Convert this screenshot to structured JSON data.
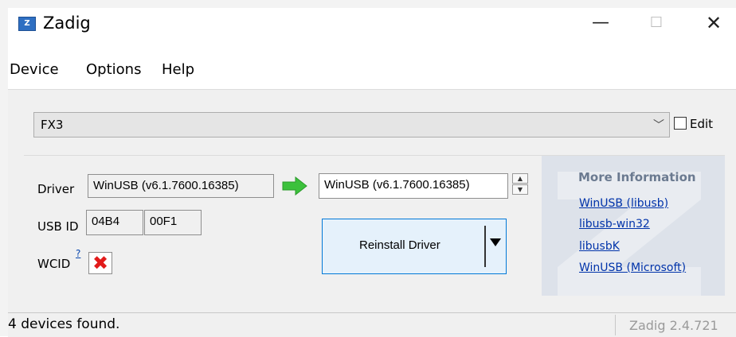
{
  "window": {
    "title": "Zadig",
    "icon_letter": "Z",
    "minimize_glyph": "—",
    "maximize_glyph": "☐",
    "close_glyph": "✕"
  },
  "menu": {
    "items": [
      "Device",
      "Options",
      "Help"
    ]
  },
  "device": {
    "selected": "FX3",
    "edit_label": "Edit",
    "edit_checked": false
  },
  "driver": {
    "label": "Driver",
    "current": "WinUSB (v6.1.7600.16385)",
    "target": "WinUSB (v6.1.7600.16385)",
    "arrow_color": "#3cc13c"
  },
  "usb_id": {
    "label": "USB ID",
    "vid": "04B4",
    "pid": "00F1"
  },
  "wcid": {
    "label": "WCID",
    "help_link": "?",
    "status_glyph": "✖"
  },
  "action": {
    "reinstall_label": "Reinstall Driver"
  },
  "info": {
    "title": "More Information",
    "links": [
      "WinUSB (libusb)",
      "libusb-win32",
      "libusbK",
      "WinUSB (Microsoft)"
    ]
  },
  "status": {
    "message": "4 devices found.",
    "version": "Zadig 2.4.721"
  }
}
